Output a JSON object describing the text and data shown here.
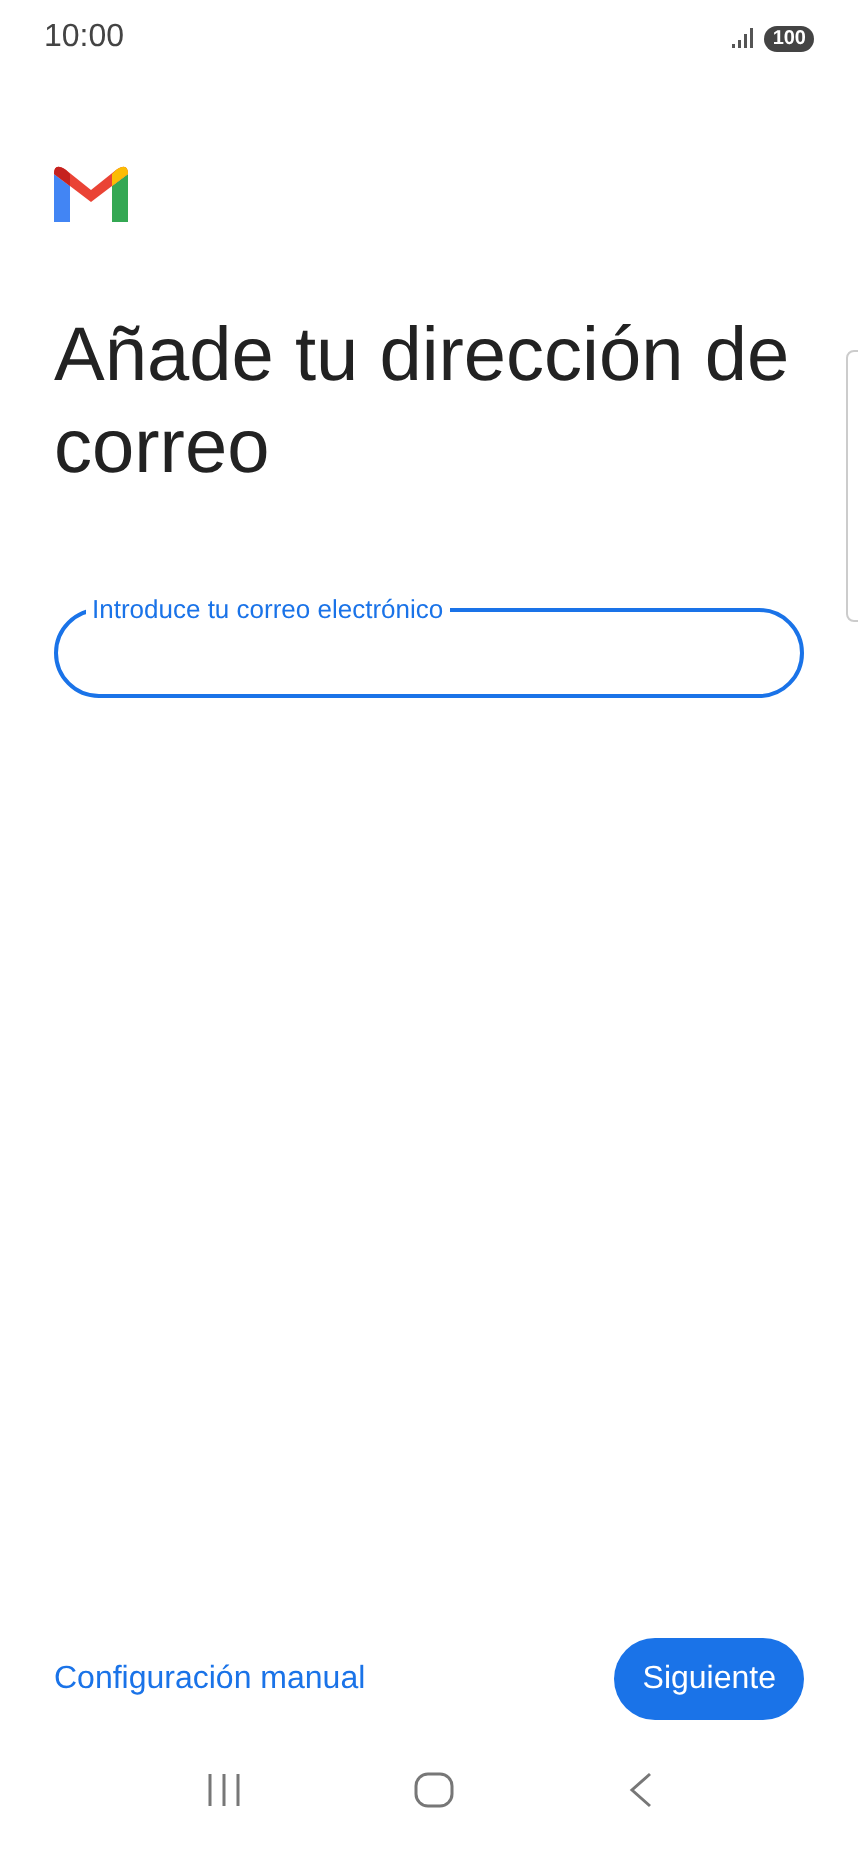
{
  "status_bar": {
    "time": "10:00",
    "battery": "100"
  },
  "title": "Añade tu dirección de correo",
  "email_field": {
    "label": "Introduce tu correo electrónico"
  },
  "actions": {
    "manual_link": "Configuración manual",
    "next_button": "Siguiente"
  }
}
